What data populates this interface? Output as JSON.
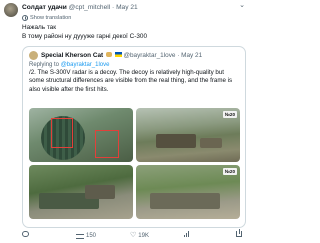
{
  "tweet": {
    "author_name": "Солдат удачи",
    "author_handle": "@cpt_mitchell",
    "separator": "·",
    "date": "May 21",
    "translation_label": "Show translation",
    "text_line1": "Нажаль так",
    "text_line2": "В тому районі ну дуууже гарні декої С-300"
  },
  "quote": {
    "author_name": "Special Kherson Cat",
    "author_handle": "@bayraktar_1love",
    "separator": "·",
    "date": "May 21",
    "replying_prefix": "Replying to",
    "replying_handle": "@bayraktar_1love",
    "text": "/2. The S-300V radar is a decoy. The decoy is relatively high-quality but some structural differences are visible from the real thing, and the frame is also visible after the first hits.",
    "media_badges": [
      "№20",
      "№20"
    ]
  },
  "actions": {
    "replies": "",
    "retweets": "150",
    "likes": "19K",
    "views": "",
    "reply_icon": "reply-icon",
    "retweet_icon": "retweet-icon",
    "like_icon": "heart-icon",
    "views_icon": "views-icon",
    "share_icon": "share-icon"
  },
  "colors": {
    "link": "#1d9bf0",
    "muted": "#536471",
    "border": "#cfd9de",
    "highlight_box": "#e2403a"
  }
}
